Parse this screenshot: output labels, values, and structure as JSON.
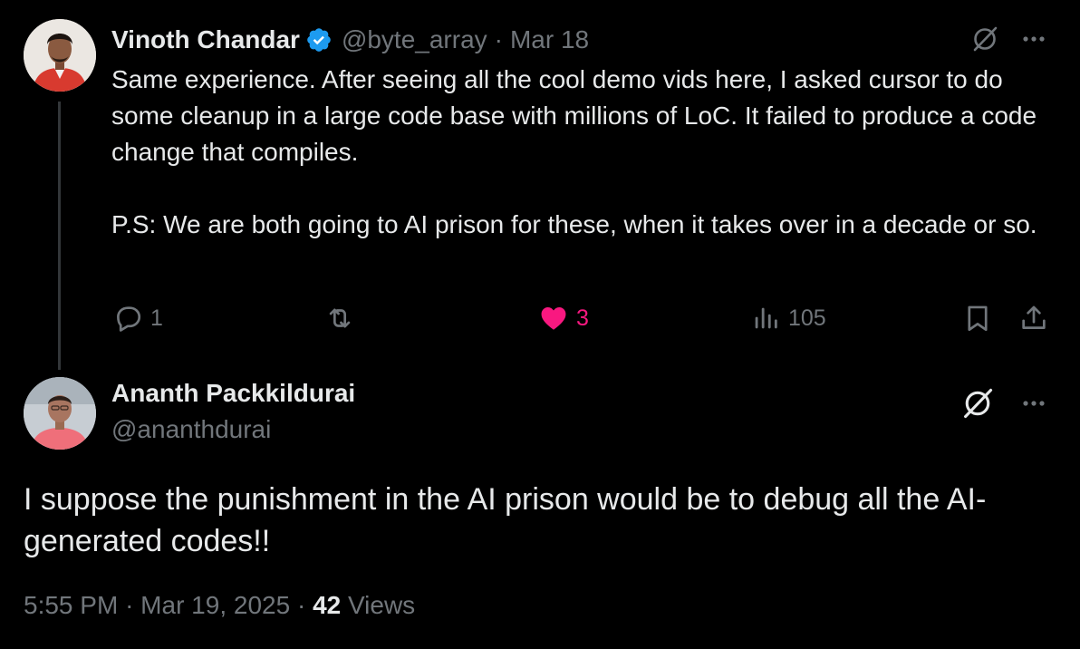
{
  "reply_tweet": {
    "author_name": "Vinoth Chandar",
    "handle": "@byte_array",
    "separator": "·",
    "date": "Mar 18",
    "verified": true,
    "paragraphs": [
      "Same experience. After seeing all the cool demo vids here, I asked cursor to do some cleanup in a large code base with millions of LoC. It failed to produce a code change that compiles.",
      "P.S: We are both going to AI prison for these, when it takes over in a decade or so."
    ],
    "actions": {
      "replies": "1",
      "retweets": "",
      "likes": "3",
      "views": "105"
    },
    "icons": [
      "verified-badge-icon",
      "grok-icon",
      "more-icon",
      "reply-icon",
      "retweet-icon",
      "heart-icon",
      "views-icon",
      "bookmark-icon",
      "share-icon"
    ]
  },
  "main_tweet": {
    "author_name": "Ananth Packkildurai",
    "handle": "@ananthdurai",
    "text": "I suppose the punishment in the AI prison would be to debug all the AI-generated codes!!",
    "time": "5:55 PM",
    "separator": "·",
    "date": "Mar 19, 2025",
    "views_count": "42",
    "views_label": "Views"
  },
  "colors": {
    "background": "#000000",
    "text": "#e7e9ea",
    "muted": "#71767b",
    "like": "#f91880",
    "verified": "#1d9bf0"
  }
}
